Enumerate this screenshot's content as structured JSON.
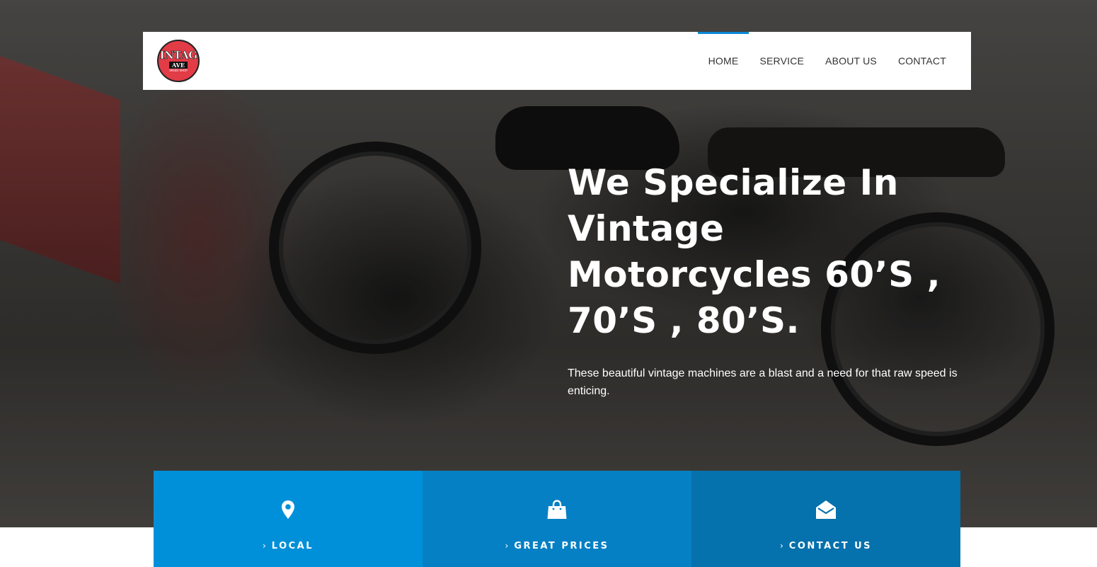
{
  "brand": {
    "logo_top": "VINTAGE",
    "logo_bottom": "AVE",
    "logo_sub": "SPEED SHOP"
  },
  "nav": {
    "items": [
      {
        "label": "HOME",
        "active": true
      },
      {
        "label": "SERVICE",
        "active": false
      },
      {
        "label": "ABOUT US",
        "active": false
      },
      {
        "label": "CONTACT",
        "active": false
      }
    ]
  },
  "hero": {
    "title": "We Specialize In Vintage Motorcycles 60’S , 70’S , 80’S.",
    "subtitle": "These beautiful vintage machines are a blast and a need for that raw speed is enticing."
  },
  "features": [
    {
      "label": "LOCAL",
      "icon": "map-pin-icon",
      "color": "#0090d9"
    },
    {
      "label": "GREAT PRICES",
      "icon": "shopping-bag-icon",
      "color": "#0680c4"
    },
    {
      "label": "CONTACT US",
      "icon": "envelope-open-icon",
      "color": "#0571ad"
    }
  ],
  "colors": {
    "accent": "#0a89d6",
    "header_bg": "#ffffff",
    "nav_text": "#333333"
  }
}
